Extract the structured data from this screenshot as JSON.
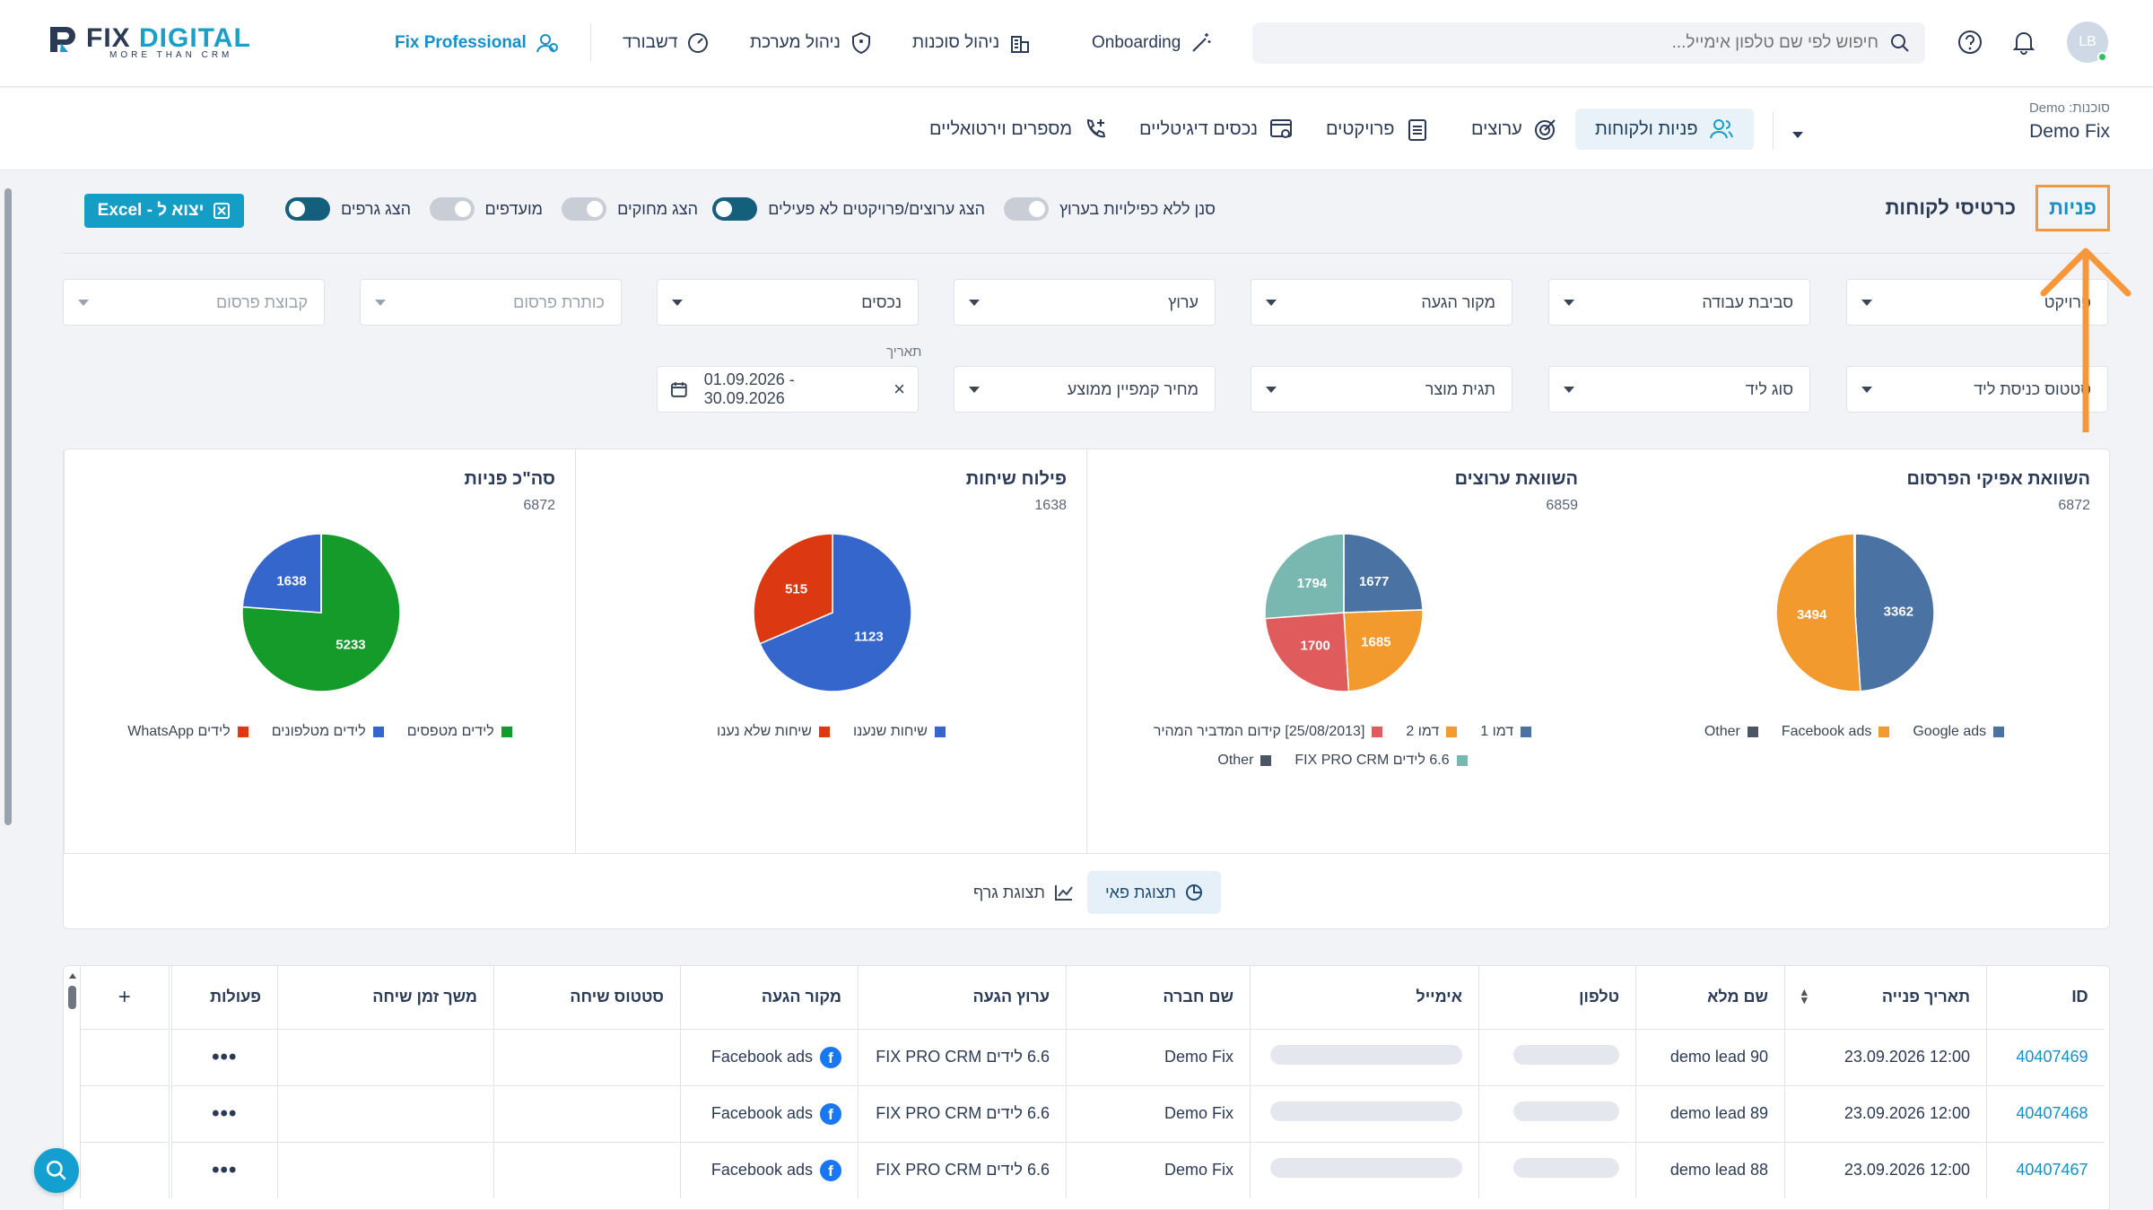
{
  "brand": {
    "logo_fix": "FIX",
    "logo_digital": "DIGITAL",
    "tagline": "MORE THAN CRM"
  },
  "top_nav": {
    "pro": "Fix Professional",
    "dashboard": "דשבורד",
    "system_admin": "ניהול מערכת",
    "agencies": "ניהול סוכנות",
    "onboarding": "Onboarding",
    "search_placeholder": "חיפוש לפי שם טלפון אימייל...",
    "avatar": "LB"
  },
  "agency": {
    "label": "סוכנות: Demo",
    "name": "Demo Fix"
  },
  "tabs": [
    {
      "label": "פניות ולקוחות"
    },
    {
      "label": "ערוצים"
    },
    {
      "label": "פרויקטים"
    },
    {
      "label": "נכסים דיגיטליים"
    },
    {
      "label": "מספרים וירטואליים"
    }
  ],
  "page_tabs": {
    "leads": "פניות",
    "customer_cards": "כרטיסי לקוחות"
  },
  "toggles": [
    {
      "label": "סנן ללא כפילויות בערוץ",
      "on": false
    },
    {
      "label": "הצג ערוצים/פרויקטים לא פעילים",
      "on": true
    },
    {
      "label": "הצג מחוקים",
      "on": false
    },
    {
      "label": "מועדפים",
      "on": false
    },
    {
      "label": "הצג גרפים",
      "on": true
    }
  ],
  "excel_button": "יצוא ל - Excel",
  "filters_row1": [
    "פרויקט",
    "סביבת עבודה",
    "מקור הגעה",
    "ערוץ",
    "נכסים",
    "כותרת פרסום",
    "קבוצת פרסום"
  ],
  "filters_row2": [
    "סטטוס כניסת ליד",
    "סוג ליד",
    "תגית מוצר",
    "מחיר קמפיין ממוצע"
  ],
  "date": {
    "label": "תאריך",
    "value": "01.09.2026 - 30.09.2026",
    "clear": "×"
  },
  "charts": [
    {
      "title": "השוואת אפיקי הפרסום",
      "total": "6872",
      "slices": [
        {
          "label": "Google ads",
          "value": 3362,
          "color": "#4a72a3"
        },
        {
          "label": "Facebook ads",
          "value": 3494,
          "color": "#f39a2e"
        },
        {
          "label": "Other",
          "value": 16,
          "color": "#4b5563"
        }
      ]
    },
    {
      "title": "השוואת ערוצים",
      "total": "6859",
      "slices": [
        {
          "label": "דמו 1",
          "value": 1677,
          "color": "#4a72a3"
        },
        {
          "label": "דמו 2",
          "value": 1685,
          "color": "#f39a2e"
        },
        {
          "label": "[25/08/2013] קידום המדביר המהיר",
          "value": 1700,
          "color": "#e05b5b"
        },
        {
          "label": "6.6 לידים FIX PRO CRM",
          "value": 1794,
          "color": "#79b8b0"
        },
        {
          "label": "Other",
          "value": 3,
          "color": "#4b5563"
        }
      ]
    },
    {
      "title": "פילוח שיחות",
      "total": "1638",
      "slices": [
        {
          "label": "שיחות שנענו",
          "value": 1123,
          "color": "#3466cc"
        },
        {
          "label": "שיחות שלא נענו",
          "value": 515,
          "color": "#dc3912"
        }
      ]
    },
    {
      "title": "סה\"כ פניות",
      "total": "6872",
      "slices": [
        {
          "label": "לידים מטפסים",
          "value": 5233,
          "color": "#149b2a"
        },
        {
          "label": "לידים מטלפונים",
          "value": 1638,
          "color": "#3466cc"
        },
        {
          "label": "לידים WhatsApp",
          "value": 1,
          "color": "#dc3912"
        }
      ]
    }
  ],
  "view_buttons": {
    "pie": "תצוגת פאי",
    "graph": "תצוגת גרף"
  },
  "table": {
    "headers": [
      "ID",
      "תאריך פנייה",
      "שם מלא",
      "טלפון",
      "אימייל",
      "שם חברה",
      "ערוץ הגעה",
      "מקור הגעה",
      "סטטוס שיחה",
      "משך זמן שיחה",
      "פעולות",
      "+"
    ],
    "rows": [
      {
        "id": "40407469",
        "date": "12:00 23.09.2026",
        "name": "demo lead 90",
        "company": "Demo Fix",
        "channel": "6.6 לידים FIX PRO CRM",
        "source": "Facebook ads",
        "actions": "•••"
      },
      {
        "id": "40407468",
        "date": "12:00 23.09.2026",
        "name": "demo lead 89",
        "company": "Demo Fix",
        "channel": "6.6 לידים FIX PRO CRM",
        "source": "Facebook ads",
        "actions": "•••"
      },
      {
        "id": "40407467",
        "date": "12:00 23.09.2026",
        "name": "demo lead 88",
        "company": "Demo Fix",
        "channel": "6.6 לידים FIX PRO CRM",
        "source": "Facebook ads",
        "actions": "•••"
      }
    ]
  },
  "icons": [
    "logo-icon",
    "pro-icon",
    "dashboard-icon",
    "shield-icon",
    "building-icon",
    "wand-icon",
    "search-icon",
    "help-icon",
    "bell-icon",
    "excel-icon",
    "calendar-icon",
    "pie-icon",
    "line-chart-icon",
    "facebook-icon",
    "sort-icon"
  ],
  "colors": {
    "accent": "#1490c8",
    "highlight": "#f6973c",
    "toggle_on": "#145f7c"
  }
}
